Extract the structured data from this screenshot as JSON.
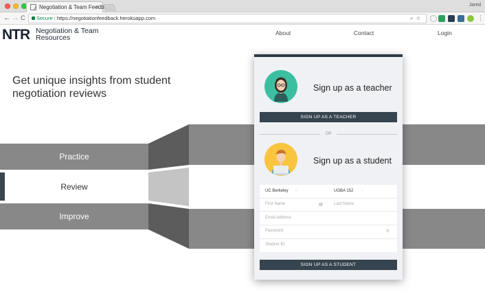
{
  "browser": {
    "tab_title": "Negotiation & Team Feedback",
    "tab_close": "×",
    "profile_name": "Jared",
    "secure_label": "Secure",
    "url": "https://negotiationfeedback.herokuapp.com",
    "nav_back": "←",
    "nav_forward": "→",
    "nav_reload": "C"
  },
  "site": {
    "logo_mark": "NTR",
    "logo_line1": "Negotiation & Team",
    "logo_line2": "Resources",
    "nav": {
      "about": "About",
      "contact": "Contact",
      "login": "Login"
    },
    "hero_line1": "Get unique insights from student",
    "hero_line2": "negotiation reviews"
  },
  "funnel": {
    "practice": "Practice",
    "review": "Review",
    "improve": "Improve"
  },
  "signup": {
    "teacher_title": "Sign up as a teacher",
    "teacher_button": "SIGN UP AS A TEACHER",
    "or_label": "OR",
    "student_title": "Sign up as a student",
    "school_value": "UC Berkeley",
    "course_value": "UGBA 152",
    "dash": "-",
    "first_name_placeholder": "First Name",
    "last_name_placeholder": "Last Name",
    "email_placeholder": "Email address",
    "password_placeholder": "Password",
    "student_id_placeholder": "Student ID",
    "student_button": "SIGN UP AS A STUDENT"
  },
  "colors": {
    "dark_slate": "#36444f",
    "teacher_avatar_bg": "#3bbfa0",
    "student_avatar_bg": "#f9c43f",
    "funnel_gray": "#888888"
  }
}
